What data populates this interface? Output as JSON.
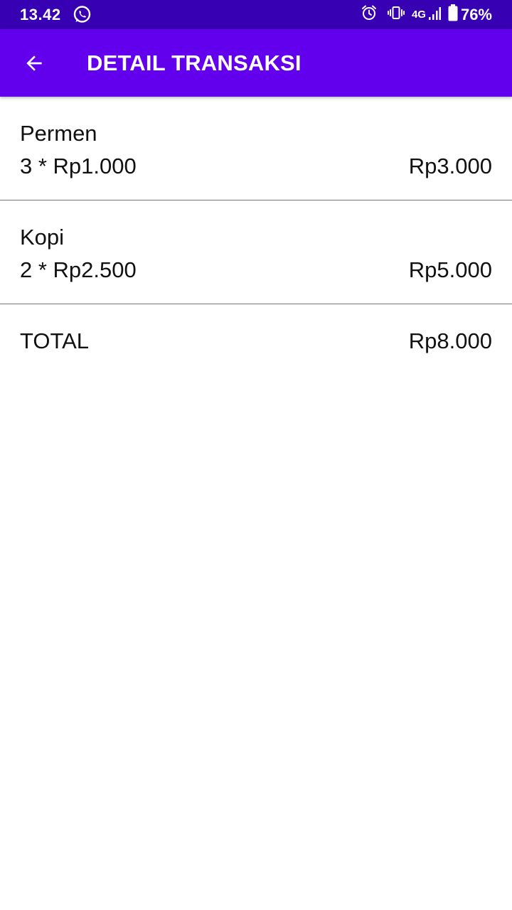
{
  "status_bar": {
    "time": "13.42",
    "network": "4G",
    "battery": "76%",
    "color": "#3700b3",
    "icons": [
      "whatsapp-icon",
      "alarm-icon",
      "vibrate-icon",
      "signal-icon",
      "battery-icon"
    ]
  },
  "app_bar": {
    "title": "DETAIL TRANSAKSI",
    "back_icon": "arrow-back-icon",
    "color": "#6200ee"
  },
  "items": [
    {
      "name": "Permen",
      "qty_price": "3 * Rp1.000",
      "subtotal": "Rp3.000"
    },
    {
      "name": "Kopi",
      "qty_price": "2 * Rp2.500",
      "subtotal": "Rp5.000"
    }
  ],
  "total": {
    "label": "TOTAL",
    "value": "Rp8.000"
  }
}
